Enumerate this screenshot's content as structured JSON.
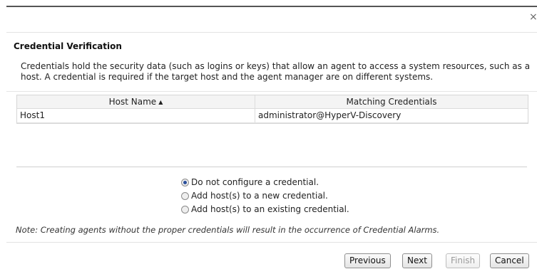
{
  "dialog": {
    "close_glyph": "×",
    "title": "Credential Verification",
    "description": "Credentials hold the security data (such as logins or keys) that allow an agent to access a system resources, such as a host. A credential is required if the target host and the agent manager are on different systems."
  },
  "table": {
    "columns": [
      "Host Name",
      "Matching Credentials"
    ],
    "sort_glyph": "▲",
    "rows": [
      {
        "host": "Host1",
        "credential": "administrator@HyperV-Discovery"
      }
    ]
  },
  "options": [
    {
      "label": "Do not configure a credential.",
      "checked": true
    },
    {
      "label": "Add host(s) to a new credential.",
      "checked": false
    },
    {
      "label": "Add host(s) to an existing credential.",
      "checked": false
    }
  ],
  "note": "Note: Creating agents without the proper credentials will result in the occurrence of Credential Alarms.",
  "buttons": {
    "previous": "Previous",
    "next": "Next",
    "finish": "Finish",
    "cancel": "Cancel"
  }
}
